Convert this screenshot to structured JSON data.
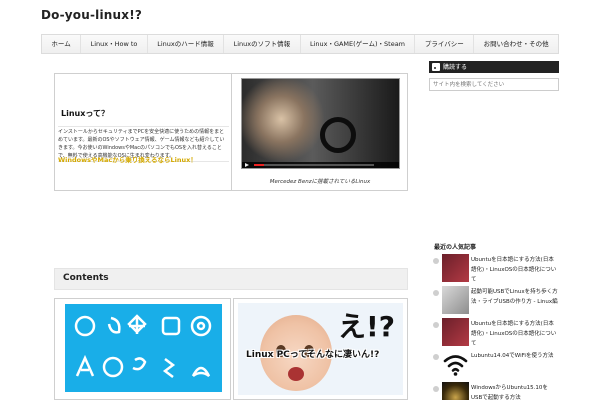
{
  "site": {
    "title": "Do-you-linux!?"
  },
  "nav": {
    "items": [
      {
        "label": "ホーム"
      },
      {
        "label": "Linux・How to"
      },
      {
        "label": "Linuxのハード情報"
      },
      {
        "label": "Linuxのソフト情報"
      },
      {
        "label": "Linux・GAME(ゲーム)・Steam"
      },
      {
        "label": "プライバシー"
      },
      {
        "label": "お問い合わせ・その他"
      }
    ]
  },
  "feature": {
    "heading": "Linuxって？",
    "description": "インストールからセキュリティまでPCを安全快適に使うための情報をまとめています。最新のOSやソフトウェア情報、ゲーム情報なども紹介していきます。今お使いのWindowsやMacのパソコンでもOSを入れ替えることで、無料で使える高機能なOSに生まれ変わります。",
    "link_text": "WindowsやMacから乗り換えるならLinux！",
    "video_caption": "Mercedez Benzに搭載されているLinux"
  },
  "contents": {
    "title": "Contents"
  },
  "card_b": {
    "exclaim": "え!?",
    "caption": "Linux PCってそんなに凄いん!?"
  },
  "sidebar": {
    "rss_label": "購読する",
    "search_placeholder": "サイト内を検索してください",
    "recent_heading": "最近の人気記事",
    "recent_posts": [
      {
        "title": "Ubuntuを日本語にする方法(日本語化)・LinuxOSの日本語化について"
      },
      {
        "title": "起動可能USBでLinuxを持ち歩く方法・ライブUSBの作り方 - Linux編"
      },
      {
        "title": "Ubuntuを日本語にする方法(日本語化)・LinuxOSの日本語化について"
      },
      {
        "title": "Lubuntu14.04でWiFiを使う方法"
      },
      {
        "title": "WindowsからUbuntu15.10をUSBで起動する方法"
      }
    ]
  },
  "colors": {
    "accent_link": "#d4a900",
    "distro_panel": "#19aee8",
    "rss_bar": "#222222"
  }
}
